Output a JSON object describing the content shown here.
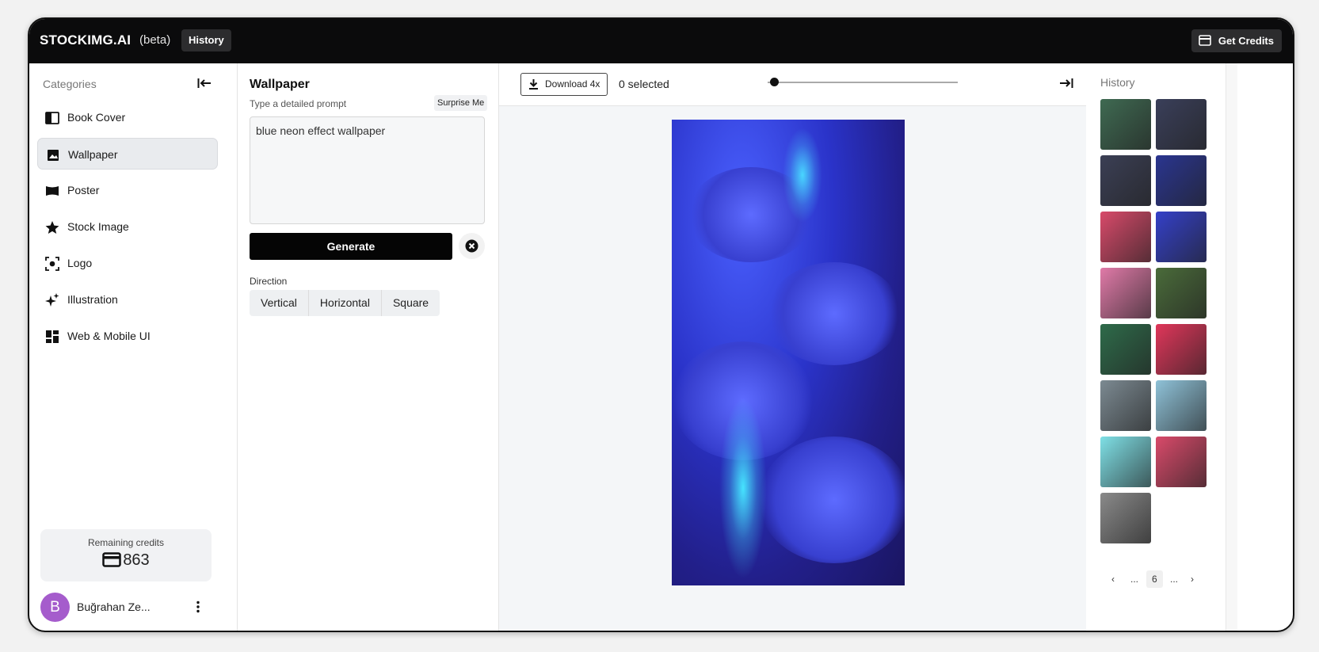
{
  "topbar": {
    "brand": "STOCKIMG.AI",
    "beta": "(beta)",
    "history_btn": "History",
    "credits_btn": "Get Credits"
  },
  "sidebar": {
    "title": "Categories",
    "items": [
      {
        "label": "Book Cover",
        "icon": "book-icon"
      },
      {
        "label": "Wallpaper",
        "icon": "image-icon"
      },
      {
        "label": "Poster",
        "icon": "flag-icon"
      },
      {
        "label": "Stock Image",
        "icon": "star-icon"
      },
      {
        "label": "Logo",
        "icon": "focus-icon"
      },
      {
        "label": "Illustration",
        "icon": "sparkles-icon"
      },
      {
        "label": "Web & Mobile UI",
        "icon": "dashboard-icon"
      }
    ],
    "active": "Wallpaper",
    "credits_label": "Remaining credits",
    "credits_value": "863",
    "user_initial": "B",
    "user_name": "Buğrahan Ze..."
  },
  "prompt": {
    "title": "Wallpaper",
    "subtitle": "Type a detailed prompt",
    "surprise": "Surprise Me",
    "value": "blue neon effect wallpaper",
    "generate": "Generate",
    "direction_label": "Direction",
    "directions": [
      "Vertical",
      "Horizontal",
      "Square"
    ]
  },
  "main": {
    "download": "Download 4x",
    "selected": "0 selected"
  },
  "history": {
    "title": "History",
    "thumb_colors": [
      "#3f6a52",
      "#3a3f5a",
      "#3b3f55",
      "#2a3590",
      "#d84a6a",
      "#3440c8",
      "#e07aa8",
      "#4a6b3a",
      "#2e6b4a",
      "#e0365a",
      "#7c8a92",
      "#8fc2d8",
      "#7fe0e6",
      "#d94a6a",
      "#8a8a8a"
    ],
    "pages": [
      "‹",
      "...",
      "6",
      "...",
      "›"
    ]
  }
}
